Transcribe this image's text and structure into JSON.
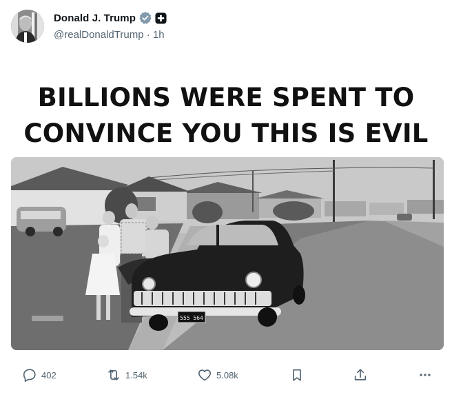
{
  "post": {
    "author": {
      "display_name": "Donald J. Trump",
      "handle": "@realDonaldTrump",
      "separator": "·",
      "time": "1h",
      "verified_icon": "verified-badge-icon",
      "affiliate_icon": "plus-badge-icon",
      "avatar_icon": "profile-photo"
    },
    "headline": {
      "line1": "BILLIONS WERE SPENT TO",
      "line2": "CONVINCE YOU THIS IS EVIL"
    },
    "image": {
      "description_icon": "black-and-white-family-photo-with-car",
      "license_plate": "555 564"
    }
  },
  "actions": {
    "replies": {
      "icon": "reply-icon",
      "count": "402"
    },
    "reposts": {
      "icon": "repost-icon",
      "count": "1.54k"
    },
    "likes": {
      "icon": "like-icon",
      "count": "5.08k"
    },
    "bookmark": {
      "icon": "bookmark-icon"
    },
    "share": {
      "icon": "share-icon"
    },
    "more": {
      "icon": "more-icon"
    }
  },
  "colors": {
    "text_primary": "#0f1419",
    "text_secondary": "#536471",
    "background": "#ffffff"
  }
}
